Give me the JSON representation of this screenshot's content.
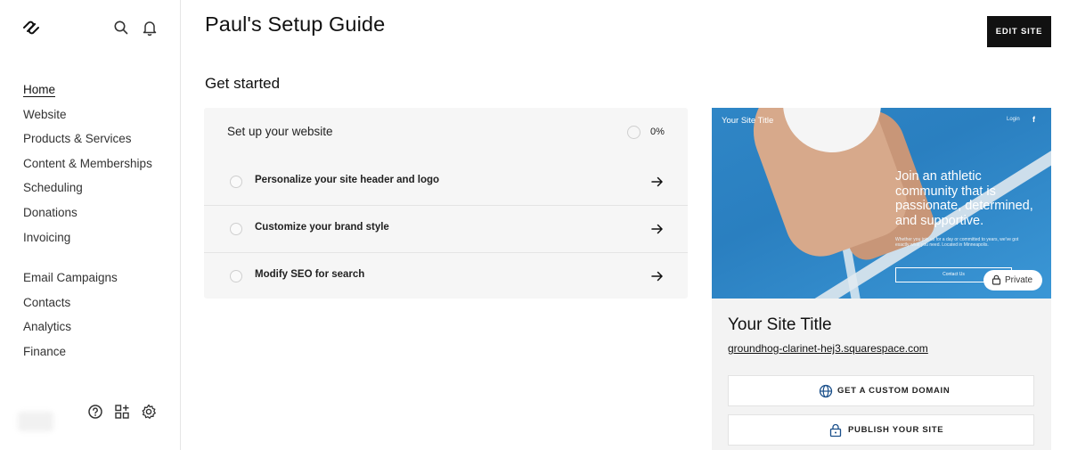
{
  "page": {
    "title": "Paul's Setup Guide",
    "edit_label": "EDIT SITE"
  },
  "sidebar": {
    "items": [
      {
        "label": "Home"
      },
      {
        "label": "Website"
      },
      {
        "label": "Products & Services"
      },
      {
        "label": "Content & Memberships"
      },
      {
        "label": "Scheduling"
      },
      {
        "label": "Donations"
      },
      {
        "label": "Invoicing"
      }
    ],
    "items2": [
      {
        "label": "Email Campaigns"
      },
      {
        "label": "Contacts"
      },
      {
        "label": "Analytics"
      },
      {
        "label": "Finance"
      }
    ],
    "icons": [
      "squarespace-logo-icon",
      "search-icon",
      "bell-icon",
      "help-icon",
      "apps-icon",
      "settings-icon"
    ]
  },
  "get_started": {
    "title": "Get started",
    "checklist_title": "Set up your website",
    "progress": "0%",
    "tasks": [
      {
        "label": "Personalize your site header and logo"
      },
      {
        "label": "Customize your brand style"
      },
      {
        "label": "Modify SEO for search"
      }
    ]
  },
  "preview": {
    "hero_site_title": "Your Site Title",
    "hero_login": "Login",
    "hero_fb": "f",
    "hero_headline": "Join an athletic community that is passionate, determined, and supportive.",
    "hero_sub": "Whether you join us for a day or committed to years, we've got exactly what you need. Located in Minneapolis.",
    "hero_cta": "Contact Us",
    "private_label": "Private",
    "site_title": "Your Site Title",
    "site_url": "groundhog-clarinet-hej3.squarespace.com",
    "custom_domain_label": "GET A CUSTOM DOMAIN",
    "publish_label": "PUBLISH YOUR SITE"
  },
  "colors": {
    "hero_blue": "#2a7fc0",
    "button_dark": "#111111",
    "panel_gray": "#f6f6f6"
  }
}
